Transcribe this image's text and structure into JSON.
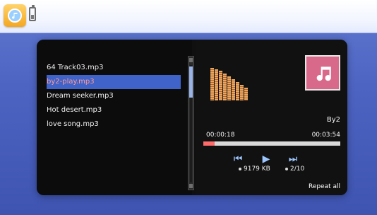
{
  "playlist": {
    "items": [
      {
        "label": "64 Track03.mp3"
      },
      {
        "label": "by2-play.mp3"
      },
      {
        "label": "Dream seeker.mp3"
      },
      {
        "label": "Hot desert.mp3"
      },
      {
        "label": "love song.mp3"
      }
    ],
    "selected_index": 1
  },
  "now_playing": {
    "artist": "By2",
    "elapsed": "00:00:18",
    "total": "00:03:54",
    "progress_fraction": 0.08,
    "file_size": "9179 KB",
    "track_index": "2/10",
    "repeat_mode": "Repeat all"
  },
  "icons": {
    "music": "music-note-icon",
    "battery": "battery-icon",
    "prev": "previous-track-icon",
    "play": "play-icon",
    "next": "next-track-icon"
  },
  "colors": {
    "selection": "#3f63c8",
    "progress_fill": "#ff6b6b",
    "cover_bg": "#d8698a"
  }
}
